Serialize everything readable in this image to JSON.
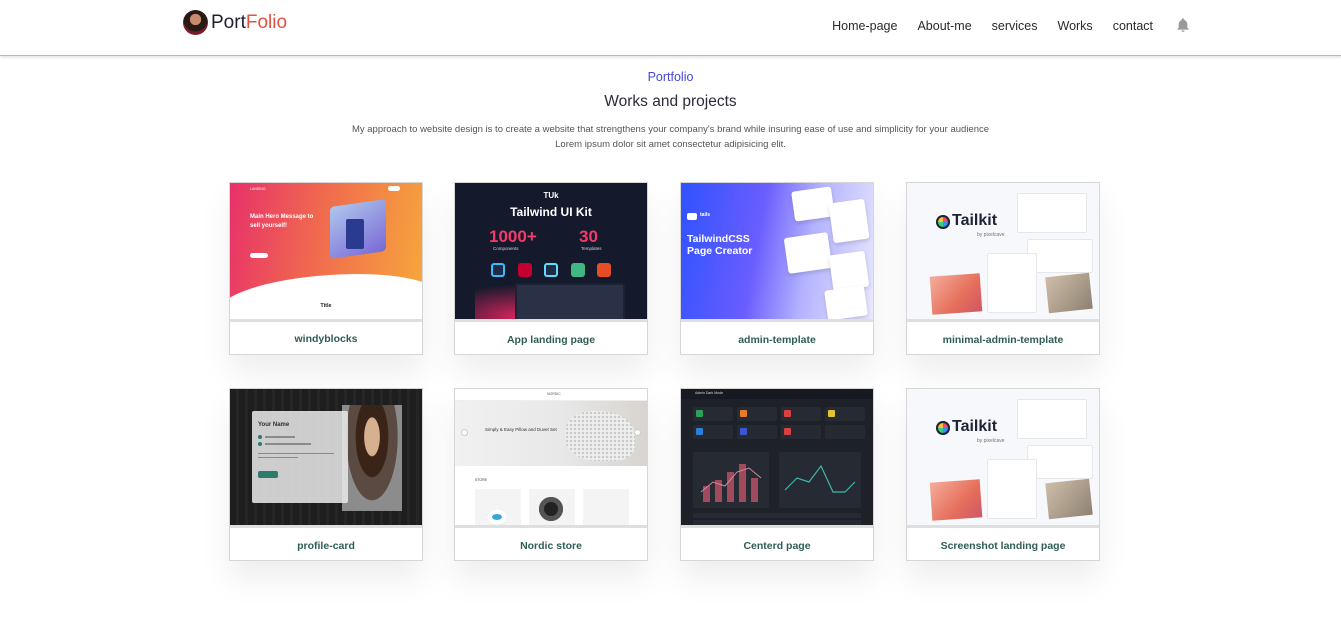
{
  "header": {
    "logo_part1": "Port",
    "logo_part2": "Folio",
    "nav": [
      "Home-page",
      "About-me",
      "services",
      "Works",
      "contact"
    ],
    "bell_icon": "bell-icon"
  },
  "section": {
    "eyebrow": "Portfolio",
    "title": "Works and projects",
    "description": "My approach to website design is to create a website that strengthens your company's brand while insuring ease of use and simplicity for your audience Lorem ipsum dolor sit amet consectetur adipisicing elit."
  },
  "projects": [
    {
      "label": "windyblocks",
      "thumb": {
        "hero": "Main Hero Message to sell yourself!",
        "sub": "Title",
        "brand": "LANDING"
      }
    },
    {
      "label": "App landing page",
      "thumb": {
        "mark": "TUk",
        "title": "Tailwind UI Kit",
        "num1": "1000+",
        "cap1": "Components",
        "num2": "30",
        "cap2": "Templates"
      }
    },
    {
      "label": "admin-template",
      "thumb": {
        "brand": "tails",
        "title1": "TailwindCSS",
        "title2": "Page Creator"
      }
    },
    {
      "label": "minimal-admin-template",
      "thumb": {
        "word": "Tailkit",
        "by": "by pixelcave"
      }
    },
    {
      "label": "profile-card",
      "thumb": {
        "name": "Your Name"
      }
    },
    {
      "label": "Nordic store",
      "thumb": {
        "brand": "NORDIC",
        "hero": "Simply & Easy Pillow and Duvet Set",
        "store": "STORE"
      }
    },
    {
      "label": "Centerd page",
      "thumb": {
        "brand": "Admin Dark Mode"
      }
    },
    {
      "label": "Screenshot landing page",
      "thumb": {
        "word": "Tailkit",
        "by": "by pixelcave"
      }
    }
  ]
}
